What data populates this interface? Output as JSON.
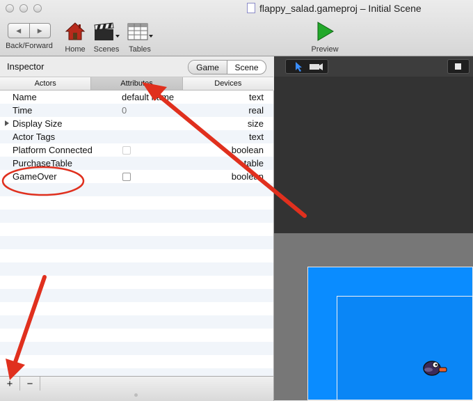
{
  "window": {
    "title": "flappy_salad.gameproj – Initial Scene"
  },
  "toolbar": {
    "back_forward_label": "Back/Forward",
    "home_label": "Home",
    "scenes_label": "Scenes",
    "tables_label": "Tables",
    "preview_label": "Preview"
  },
  "inspector": {
    "title": "Inspector",
    "toggle": [
      "Game",
      "Scene"
    ],
    "selected_toggle": "Game",
    "tabs": [
      "Actors",
      "Attributes",
      "Devices"
    ],
    "selected_tab": "Attributes",
    "rows": [
      {
        "name": "Name",
        "value": "default name",
        "type": "text"
      },
      {
        "name": "Time",
        "value": "0",
        "type": "real"
      },
      {
        "name": "Display Size",
        "value": "",
        "type": "size",
        "expandable": true
      },
      {
        "name": "Actor Tags",
        "value": "",
        "type": "text"
      },
      {
        "name": "Platform Connected",
        "value": false,
        "type": "boolean"
      },
      {
        "name": "PurchaseTable",
        "value": "",
        "type": "table"
      },
      {
        "name": "GameOver",
        "value": false,
        "type": "boolean"
      }
    ]
  },
  "bottom_bar": {
    "add_label": "+",
    "remove_label": "−"
  },
  "colors": {
    "annotation_red": "#e0301e",
    "scene_blue": "#0a8cff",
    "preview_green": "#22a82a"
  }
}
